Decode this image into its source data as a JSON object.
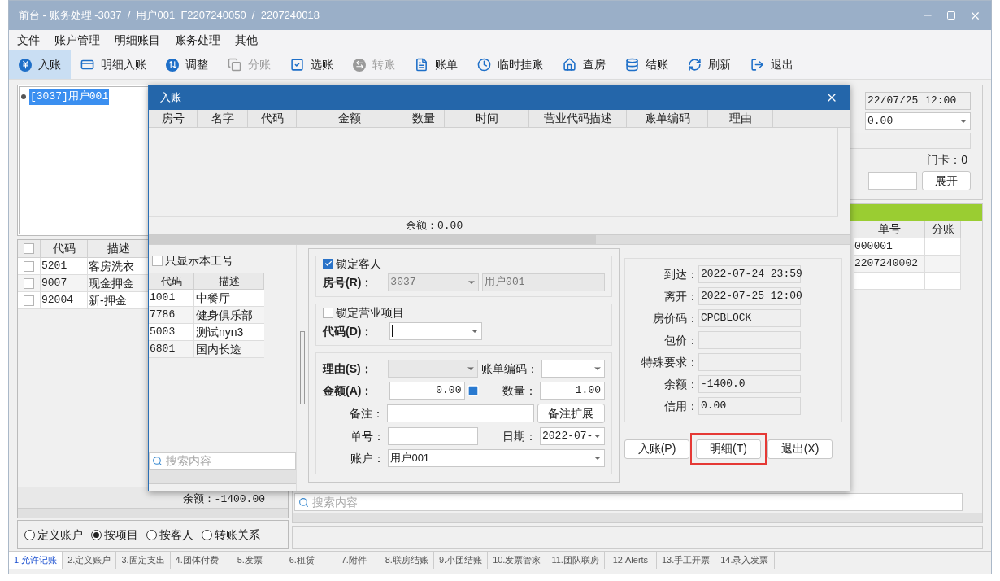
{
  "window": {
    "title": "前台 - 账务处理 -3037  /  用户001  F2207240050  /  2207240018"
  },
  "menu": [
    "文件",
    "账户管理",
    "明细账目",
    "账务处理",
    "其他"
  ],
  "toolbar": [
    {
      "label": "入账",
      "kind": "yen",
      "selected": true,
      "disabled": false
    },
    {
      "label": "明细入账",
      "kind": "card",
      "selected": false,
      "disabled": false
    },
    {
      "label": "调整",
      "kind": "updown",
      "selected": false,
      "disabled": false
    },
    {
      "label": "分账",
      "kind": "split",
      "selected": false,
      "disabled": true
    },
    {
      "label": "选账",
      "kind": "check",
      "selected": false,
      "disabled": false
    },
    {
      "label": "转账",
      "kind": "transfer",
      "selected": false,
      "disabled": true
    },
    {
      "label": "账单",
      "kind": "bill",
      "selected": false,
      "disabled": false
    },
    {
      "label": "临时挂账",
      "kind": "clock",
      "selected": false,
      "disabled": false
    },
    {
      "label": "查房",
      "kind": "house",
      "selected": false,
      "disabled": false
    },
    {
      "label": "结账",
      "kind": "db",
      "selected": false,
      "disabled": false
    },
    {
      "label": "刷新",
      "kind": "refresh",
      "selected": false,
      "disabled": false
    },
    {
      "label": "退出",
      "kind": "exit",
      "selected": false,
      "disabled": false
    }
  ],
  "tree": [
    {
      "label": "[3037]用户001",
      "selected": true
    }
  ],
  "left_table": {
    "columns": [
      "代码",
      "描述"
    ],
    "header_checked": false,
    "rows": [
      {
        "checked": false,
        "cells": [
          "5201",
          "客房洗衣"
        ]
      },
      {
        "checked": false,
        "cells": [
          "9007",
          "现金押金"
        ]
      },
      {
        "checked": false,
        "cells": [
          "92004",
          "新-押金"
        ]
      }
    ],
    "balance": "余额：-1400.00"
  },
  "view_options": [
    {
      "label": "定义账户",
      "selected": false
    },
    {
      "label": "按项目",
      "selected": true
    },
    {
      "label": "按客人",
      "selected": false
    },
    {
      "label": "转账关系",
      "selected": false
    }
  ],
  "right_top": {
    "departure": "22/07/25 12:00",
    "amount": "0.00",
    "card": "门卡：0",
    "expand_button": "展开"
  },
  "right_table": {
    "columns": [
      "单号",
      "分账"
    ],
    "rows": [
      [
        "000001",
        ""
      ],
      [
        "2207240002",
        ""
      ],
      [
        "",
        ""
      ]
    ]
  },
  "right_search": {
    "placeholder": "搜索内容"
  },
  "dialog": {
    "title": "入账",
    "grid": {
      "columns": [
        "房号",
        "名字",
        "代码",
        "金额",
        "数量",
        "时间",
        "营业代码描述",
        "账单编码",
        "理由"
      ],
      "balance": "余额：0.00"
    },
    "only_mine": {
      "label": "只显示本工号",
      "checked": false
    },
    "codes": {
      "columns": [
        "代码",
        "描述"
      ],
      "rows": [
        [
          "1001",
          "中餐厅"
        ],
        [
          "7786",
          "健身俱乐部"
        ],
        [
          "5003",
          "测试nyn3"
        ],
        [
          "6801",
          "国内长途"
        ]
      ]
    },
    "code_search": {
      "placeholder": "搜索内容"
    },
    "lock_guest": {
      "label": "锁定客人",
      "checked": true
    },
    "room": {
      "label": "房号(R)：",
      "value": "3037",
      "name": "用户001"
    },
    "lock_item": {
      "label": "锁定营业项目",
      "checked": false
    },
    "code": {
      "label": "代码(D)："
    },
    "reason": {
      "label": "理由(S)："
    },
    "bill_code": {
      "label": "账单编码："
    },
    "amount": {
      "label": "金额(A)：",
      "value": "0.00"
    },
    "quantity": {
      "label": "数量：",
      "value": "1.00"
    },
    "note": {
      "label": "备注：",
      "button": "备注扩展"
    },
    "number": {
      "label": "单号："
    },
    "date": {
      "label": "日期：",
      "value": "2022-07-"
    },
    "account": {
      "label": "账户：",
      "value": "用户001"
    },
    "info": [
      {
        "label": "到达：",
        "value": "2022-07-24  23:59"
      },
      {
        "label": "离开：",
        "value": "2022-07-25  12:00"
      },
      {
        "label": "房价码：",
        "value": "CPCBLOCK"
      },
      {
        "label": "包价："
      },
      {
        "label": "特殊要求："
      },
      {
        "label": "余额：",
        "value": "-1400.0"
      },
      {
        "label": "信用：",
        "value": "0.00"
      }
    ],
    "buttons": [
      {
        "label": "入账(P)",
        "highlighted": false
      },
      {
        "label": "明细(T)",
        "highlighted": true
      },
      {
        "label": "退出(X)",
        "highlighted": false
      }
    ]
  },
  "bottom_tabs": [
    {
      "label": "1.允许记账",
      "selected": true
    },
    {
      "label": "2.定义账户",
      "selected": false
    },
    {
      "label": "3.固定支出",
      "selected": false
    },
    {
      "label": "4.团体付费",
      "selected": false
    },
    {
      "label": "5.发票",
      "selected": false
    },
    {
      "label": "6.租赁",
      "selected": false
    },
    {
      "label": "7.附件",
      "selected": false
    },
    {
      "label": "8.联房结账",
      "selected": false
    },
    {
      "label": "9.小团结账",
      "selected": false
    },
    {
      "label": "10.发票管家",
      "selected": false
    },
    {
      "label": "11.团队联房",
      "selected": false
    },
    {
      "label": "12.Alerts",
      "selected": false
    },
    {
      "label": "13.手工开票",
      "selected": false
    },
    {
      "label": "14.录入发票",
      "selected": false
    }
  ]
}
